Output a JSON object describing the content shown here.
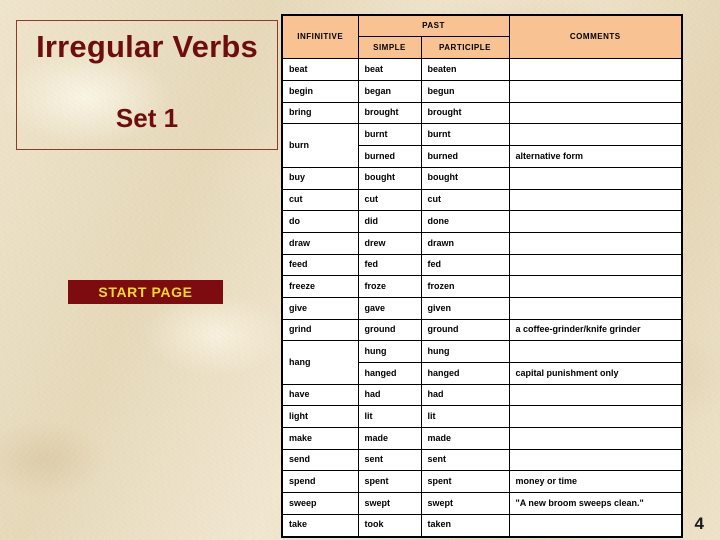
{
  "slide": {
    "title_main": "Irregular Verbs",
    "title_sub": "Set 1",
    "start_button_label": "START PAGE",
    "page_number": "4",
    "colors": {
      "background": "#eadfc5",
      "title_text": "#6e0d0d",
      "title_border": "#8a3d26",
      "button_bg": "#7d0c10",
      "button_text": "#f5d72e",
      "table_header_bg": "#f8c292",
      "table_cell_bg": "#ffffff",
      "table_border": "#000000"
    }
  },
  "table": {
    "headers": {
      "infinitive": "INFINITIVE",
      "past": "PAST",
      "simple": "SIMPLE",
      "participle": "PARTICIPLE",
      "comments": "COMMENTS"
    },
    "rows": [
      {
        "infinitive": "beat",
        "rowspan": 1,
        "simple": "beat",
        "participle": "beaten",
        "comments": ""
      },
      {
        "infinitive": "begin",
        "rowspan": 1,
        "simple": "began",
        "participle": "begun",
        "comments": ""
      },
      {
        "infinitive": "bring",
        "rowspan": 1,
        "simple": "brought",
        "participle": "brought",
        "comments": ""
      },
      {
        "infinitive": "burn",
        "rowspan": 2,
        "simple": "burnt",
        "participle": "burnt",
        "comments": ""
      },
      {
        "infinitive": null,
        "rowspan": 0,
        "simple": "burned",
        "participle": "burned",
        "comments": "alternative form"
      },
      {
        "infinitive": "buy",
        "rowspan": 1,
        "simple": "bought",
        "participle": "bought",
        "comments": ""
      },
      {
        "infinitive": "cut",
        "rowspan": 1,
        "simple": "cut",
        "participle": "cut",
        "comments": ""
      },
      {
        "infinitive": "do",
        "rowspan": 1,
        "simple": "did",
        "participle": "done",
        "comments": ""
      },
      {
        "infinitive": "draw",
        "rowspan": 1,
        "simple": "drew",
        "participle": "drawn",
        "comments": ""
      },
      {
        "infinitive": "feed",
        "rowspan": 1,
        "simple": "fed",
        "participle": "fed",
        "comments": ""
      },
      {
        "infinitive": "freeze",
        "rowspan": 1,
        "simple": "froze",
        "participle": "frozen",
        "comments": ""
      },
      {
        "infinitive": "give",
        "rowspan": 1,
        "simple": "gave",
        "participle": "given",
        "comments": ""
      },
      {
        "infinitive": "grind",
        "rowspan": 1,
        "simple": "ground",
        "participle": "ground",
        "comments": "a coffee-grinder/knife grinder"
      },
      {
        "infinitive": "hang",
        "rowspan": 2,
        "simple": "hung",
        "participle": "hung",
        "comments": ""
      },
      {
        "infinitive": null,
        "rowspan": 0,
        "simple": "hanged",
        "participle": "hanged",
        "comments": "capital punishment only"
      },
      {
        "infinitive": "have",
        "rowspan": 1,
        "simple": "had",
        "participle": "had",
        "comments": ""
      },
      {
        "infinitive": "light",
        "rowspan": 1,
        "simple": "lit",
        "participle": "lit",
        "comments": ""
      },
      {
        "infinitive": "make",
        "rowspan": 1,
        "simple": "made",
        "participle": "made",
        "comments": ""
      },
      {
        "infinitive": "send",
        "rowspan": 1,
        "simple": "sent",
        "participle": "sent",
        "comments": ""
      },
      {
        "infinitive": "spend",
        "rowspan": 1,
        "simple": "spent",
        "participle": "spent",
        "comments": "money or time"
      },
      {
        "infinitive": "sweep",
        "rowspan": 1,
        "simple": "swept",
        "participle": "swept",
        "comments": "\"A new broom sweeps clean.\""
      },
      {
        "infinitive": "take",
        "rowspan": 1,
        "simple": "took",
        "participle": "taken",
        "comments": ""
      }
    ]
  }
}
